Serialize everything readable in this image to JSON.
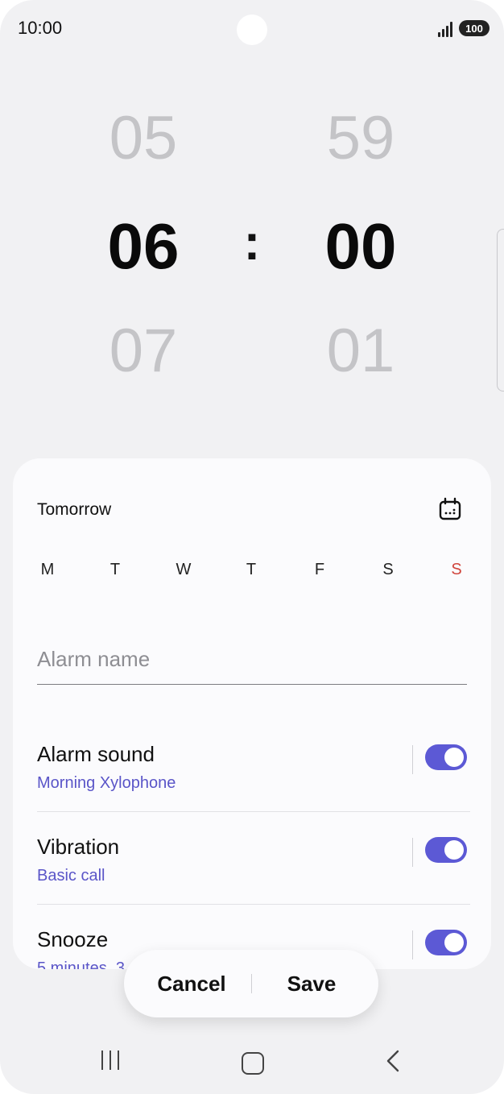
{
  "status_bar": {
    "time": "10:00",
    "battery": "100"
  },
  "time_picker": {
    "hour_prev": "05",
    "hour_selected": "06",
    "hour_next": "07",
    "separator": ":",
    "minute_prev": "59",
    "minute_selected": "00",
    "minute_next": "01"
  },
  "schedule": {
    "date_label": "Tomorrow",
    "days": [
      "M",
      "T",
      "W",
      "T",
      "F",
      "S",
      "S"
    ],
    "sunday_color": "#d0453d"
  },
  "alarm_name": {
    "placeholder": "Alarm name"
  },
  "settings": [
    {
      "title": "Alarm sound",
      "subtitle": "Morning Xylophone",
      "enabled": true
    },
    {
      "title": "Vibration",
      "subtitle": "Basic call",
      "enabled": true
    },
    {
      "title": "Snooze",
      "subtitle": "5 minutes, 3",
      "enabled": true
    }
  ],
  "actions": {
    "cancel_label": "Cancel",
    "save_label": "Save"
  },
  "colors": {
    "accent": "#5c59d5",
    "subtitle": "#5a55c8"
  }
}
